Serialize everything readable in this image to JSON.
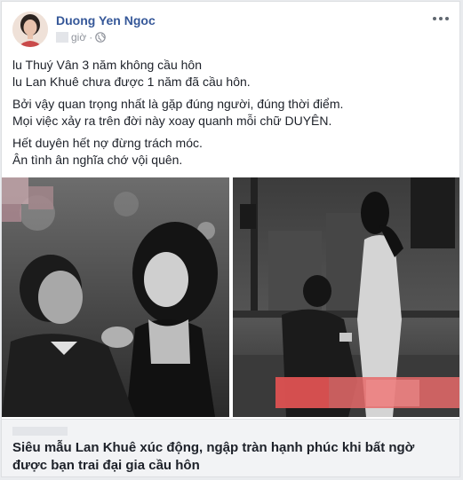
{
  "post": {
    "author": "Duong Yen Ngoc",
    "time_suffix": "giờ",
    "separator": "·",
    "paragraphs": [
      [
        "lu Thuý Vân 3 năm không cầu hôn",
        "lu Lan Khuê chưa được 1 năm đã cầu hôn."
      ],
      [
        "Bởi vậy quan trọng nhất là gặp đúng người, đúng thời điểm.",
        "Mọi việc xảy ra trên đời này xoay quanh mỗi chữ DUYÊN."
      ],
      [
        "Hết duyên hết nợ đừng trách móc.",
        "Ân tình ân nghĩa chớ vội quên."
      ]
    ]
  },
  "link": {
    "title_line1": "Siêu mẫu Lan Khuê xúc động, ngập tràn hạnh phúc khi bất ngờ",
    "title_line2": "được bạn trai đại gia cầu hôn"
  },
  "icons": {
    "globe": "globe-icon",
    "more": "more-options-icon"
  },
  "colors": {
    "author": "#365899",
    "text": "#1d2129",
    "meta": "#90949c",
    "preview_bg": "#f2f3f5"
  }
}
